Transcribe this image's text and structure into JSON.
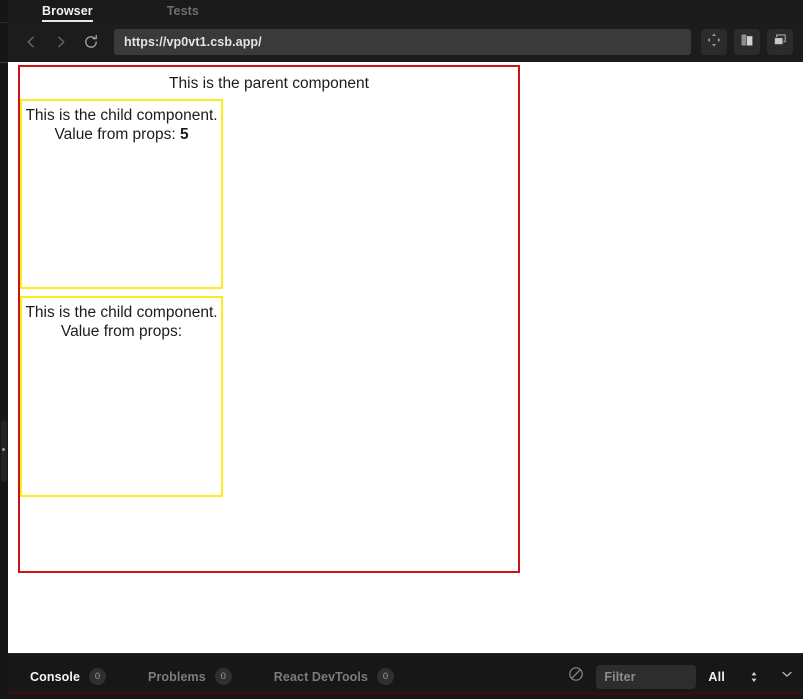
{
  "tabs": {
    "browser": "Browser",
    "tests": "Tests"
  },
  "toolbar": {
    "back_icon": "chevron-left-icon",
    "forward_icon": "chevron-right-icon",
    "reload_icon": "reload-icon",
    "url": "https://vp0vt1.csb.app/",
    "url_placeholder": "Enter URL",
    "responsive_icon": "responsive-mode-icon",
    "split_view_icon": "split-view-icon",
    "external_window_icon": "open-in-new-window-icon"
  },
  "page": {
    "parent_title": "This is the parent component",
    "children": [
      {
        "line1": "This is the child component.",
        "line2_label": "Value from props:",
        "line2_value": "5"
      },
      {
        "line1": "This is the child component.",
        "line2_label": "Value from props:",
        "line2_value": ""
      }
    ],
    "parent_border_color": "#cc1313",
    "child_border_color": "#fbec1e"
  },
  "statusbar": {
    "tabs": [
      {
        "label": "Console",
        "count": "0"
      },
      {
        "label": "Problems",
        "count": "0"
      },
      {
        "label": "React DevTools",
        "count": "0"
      }
    ],
    "clear_icon": "clear-console-icon",
    "filter_placeholder": "Filter",
    "filter_value": "",
    "log_level": "All",
    "stepper_icon": "stepper-up-down-icon",
    "collapse_icon": "chevron-down-icon"
  }
}
